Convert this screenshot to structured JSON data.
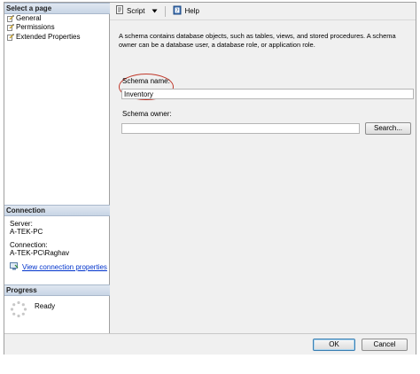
{
  "sidebar": {
    "select_page_header": "Select a page",
    "pages": [
      {
        "label": "General",
        "icon": "wrench-page-icon"
      },
      {
        "label": "Permissions",
        "icon": "wrench-page-icon"
      },
      {
        "label": "Extended Properties",
        "icon": "wrench-page-icon"
      }
    ],
    "connection_header": "Connection",
    "server_label": "Server:",
    "server_value": "A-TEK-PC",
    "connection_label": "Connection:",
    "connection_value": "A-TEK-PC\\Raghav",
    "view_connection_link": "View connection properties",
    "progress_header": "Progress",
    "progress_status": "Ready"
  },
  "toolbar": {
    "script_label": "Script",
    "help_label": "Help"
  },
  "main": {
    "description": "A schema contains database objects, such as tables, views, and stored procedures. A schema owner can be a database user, a database role, or application role.",
    "schema_name_label": "Schema name:",
    "schema_name_value": "Inventory",
    "schema_owner_label": "Schema owner:",
    "schema_owner_value": "",
    "search_button": "Search..."
  },
  "footer": {
    "ok_button": "OK",
    "cancel_button": "Cancel"
  },
  "colors": {
    "accent": "#c0392b",
    "link": "#0033cc"
  }
}
